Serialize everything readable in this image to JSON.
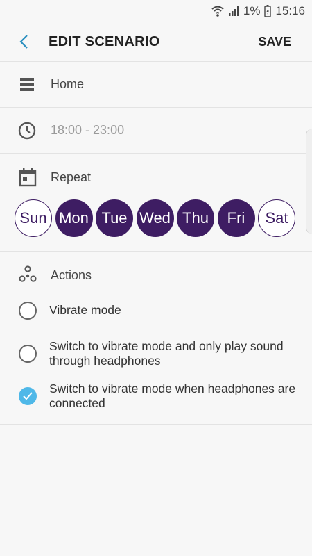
{
  "status": {
    "battery_pct": "1%",
    "time": "15:16"
  },
  "appbar": {
    "title": "EDIT SCENARIO",
    "save_label": "SAVE"
  },
  "name_row": {
    "value": "Home",
    "icon": "list-icon"
  },
  "time_row": {
    "value": "18:00 - 23:00",
    "icon": "clock-icon"
  },
  "repeat": {
    "label": "Repeat",
    "days": [
      {
        "label": "Sun",
        "selected": false
      },
      {
        "label": "Mon",
        "selected": true
      },
      {
        "label": "Tue",
        "selected": true
      },
      {
        "label": "Wed",
        "selected": true
      },
      {
        "label": "Thu",
        "selected": true
      },
      {
        "label": "Fri",
        "selected": true
      },
      {
        "label": "Sat",
        "selected": false
      }
    ]
  },
  "actions": {
    "label": "Actions",
    "options": [
      {
        "label": "Vibrate mode",
        "checked": false
      },
      {
        "label": "Switch to vibrate mode and only play sound through headphones",
        "checked": false
      },
      {
        "label": "Switch to vibrate mode when headphones are connected",
        "checked": true
      }
    ]
  },
  "colors": {
    "accent_purple": "#3e1d63",
    "check_blue": "#4fb8e8",
    "back_arrow": "#2a8fbf"
  }
}
